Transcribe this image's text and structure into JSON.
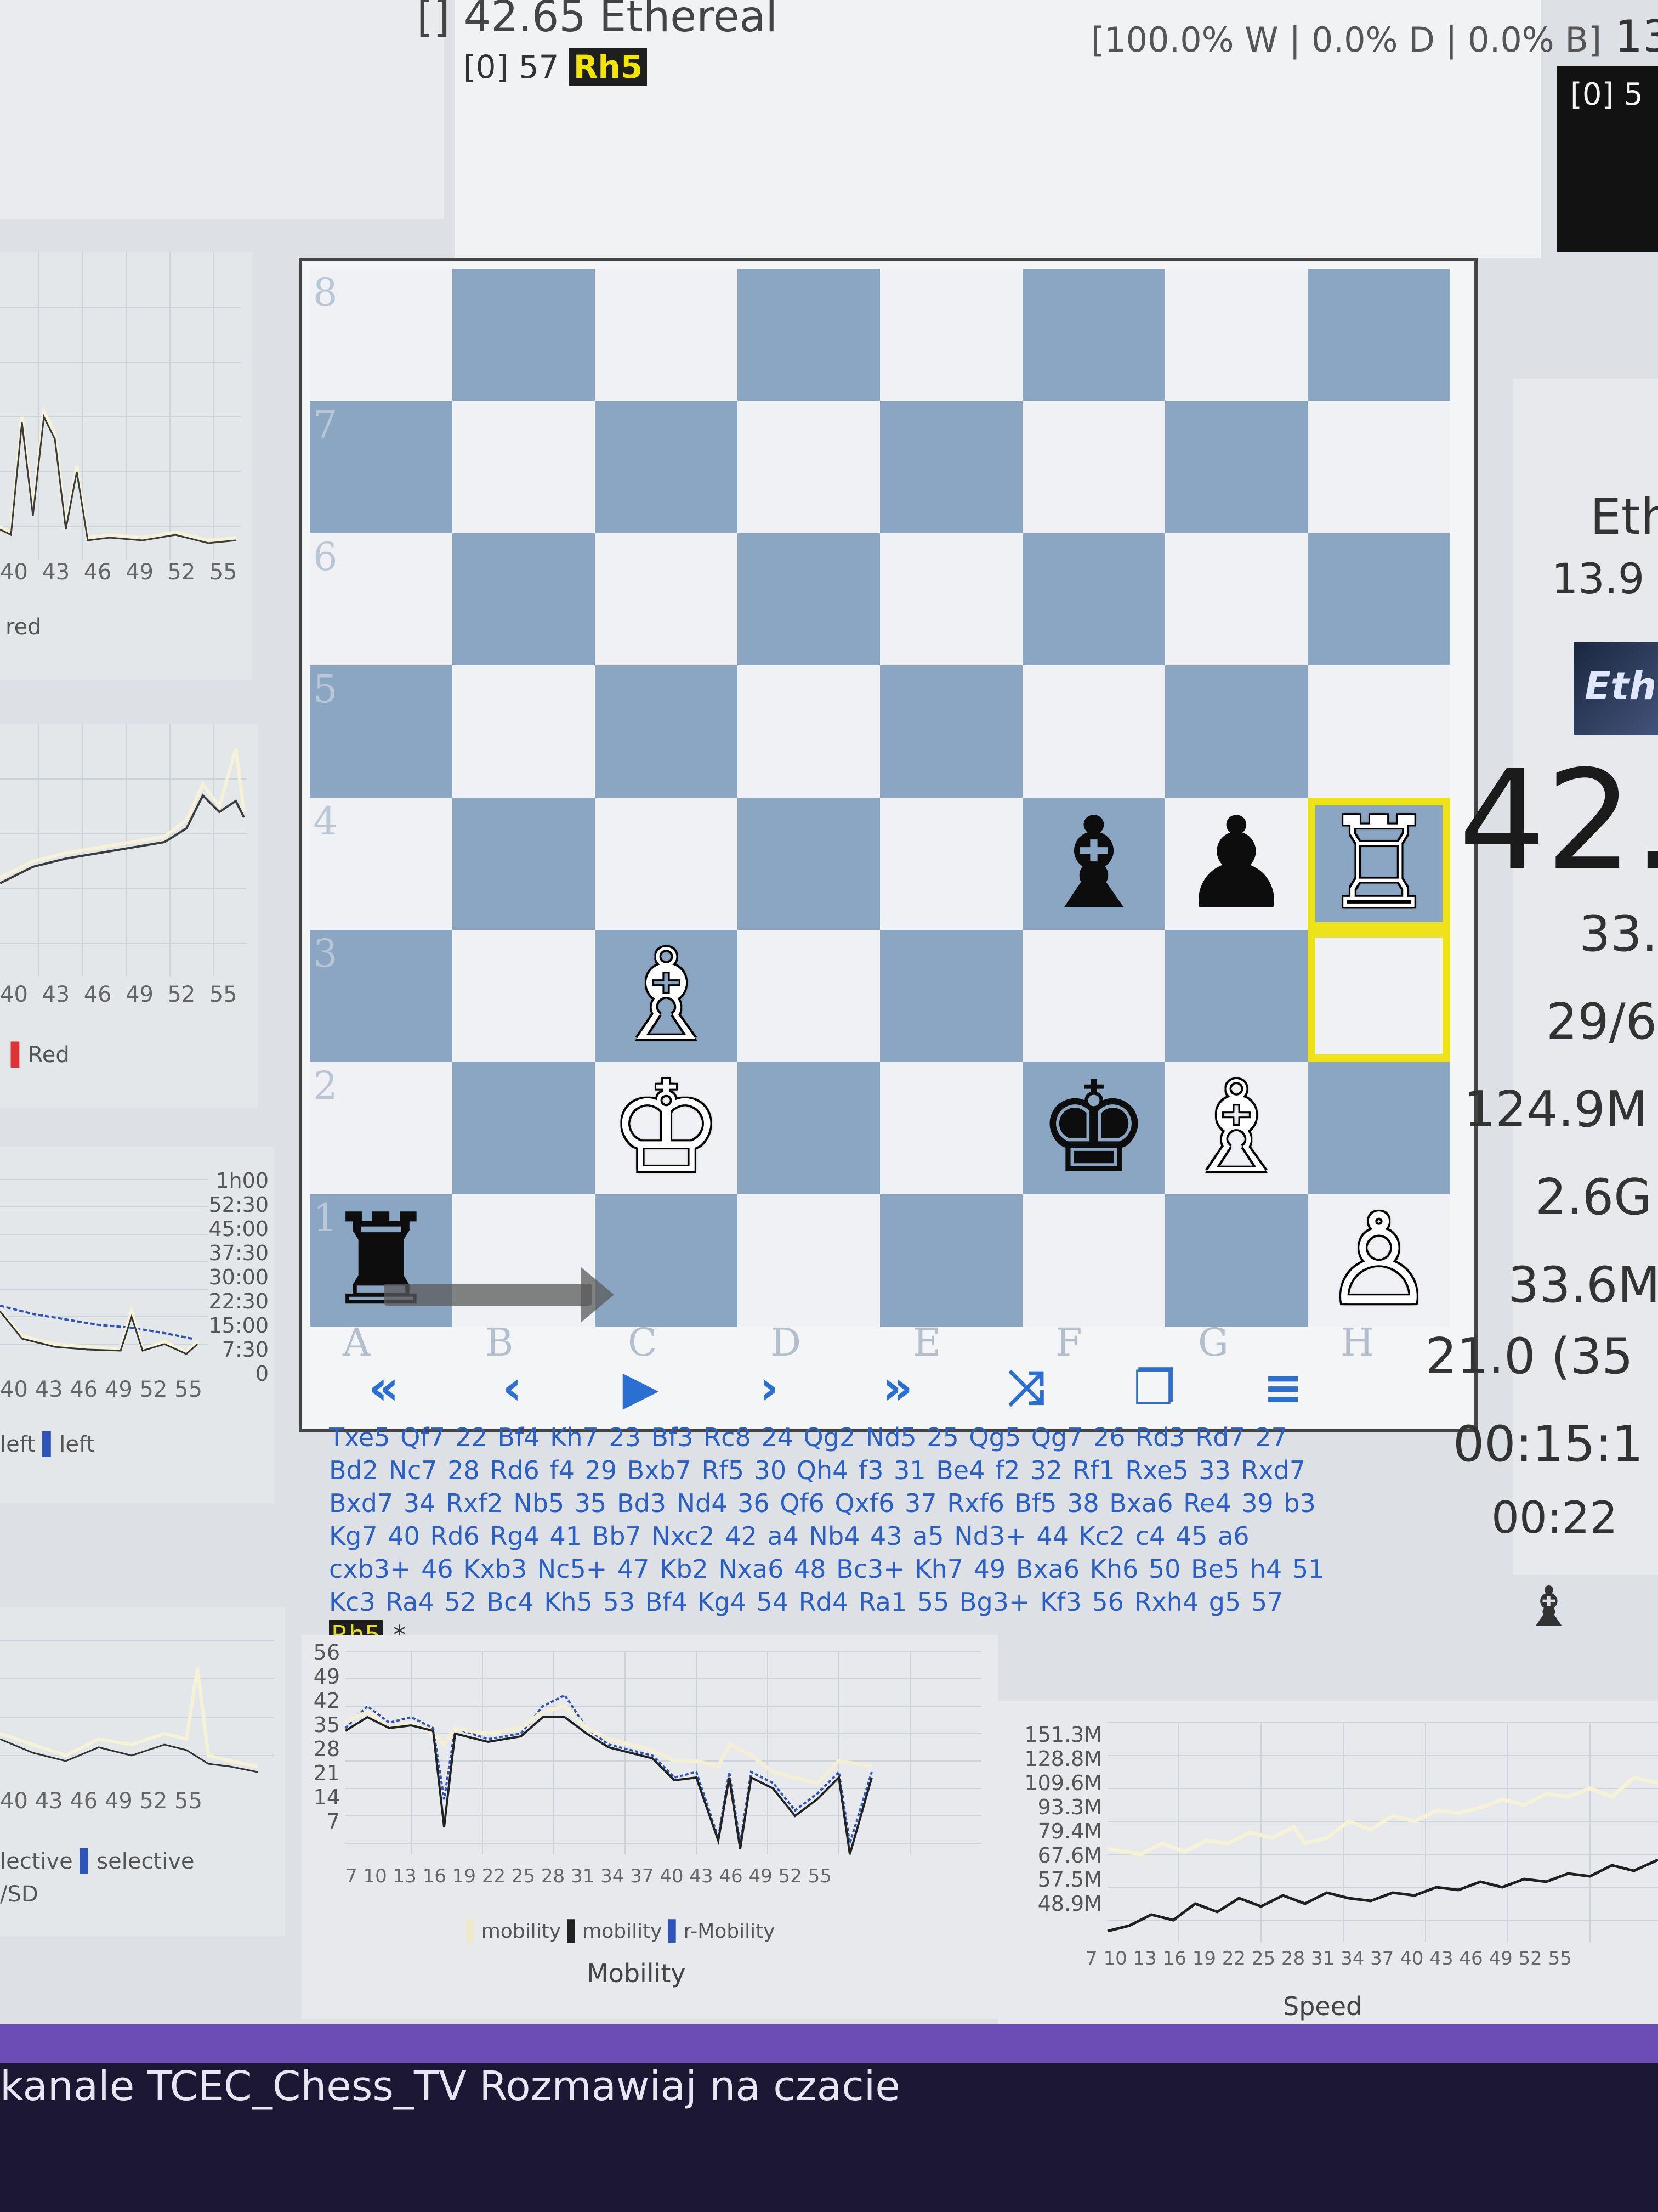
{
  "header": {
    "engine_line_prefix": "[] 42.65",
    "engine_name": "Ethereal",
    "pv_index": "[0]",
    "move_number": "57",
    "current_move": "Rh5",
    "wdl": "[100.0% W | 0.0% D | 0.0% B]",
    "wdl_extra": "13.",
    "right_pv_index": "[0] 5"
  },
  "board": {
    "rank_labels": [
      "8",
      "7",
      "6",
      "5",
      "4",
      "3",
      "2",
      "1"
    ],
    "file_labels": [
      "A",
      "B",
      "C",
      "D",
      "E",
      "F",
      "G",
      "H"
    ],
    "pieces": [
      {
        "square": "f4",
        "symbol": "♝",
        "color": "black"
      },
      {
        "square": "g4",
        "symbol": "♟",
        "color": "black"
      },
      {
        "square": "h4",
        "symbol": "♖",
        "color": "white"
      },
      {
        "square": "c3",
        "symbol": "♗",
        "color": "white"
      },
      {
        "square": "c2",
        "symbol": "♔",
        "color": "white"
      },
      {
        "square": "f2",
        "symbol": "♚",
        "color": "black"
      },
      {
        "square": "g2",
        "symbol": "♗",
        "color": "white"
      },
      {
        "square": "h1",
        "symbol": "♙",
        "color": "white"
      },
      {
        "square": "a1",
        "symbol": "♜",
        "color": "black"
      }
    ],
    "highlighted_squares": [
      "h4",
      "h3"
    ],
    "arrow": "a1-c1"
  },
  "controls": {
    "first": "«",
    "prev": "‹",
    "play": "▶",
    "next": "›",
    "last": "»",
    "flip": "⤨",
    "copy": "❐",
    "menu": "≡"
  },
  "pgn": {
    "moves_text": "Txe5 Qf7 22 Bf4 Kh7 23 Bf3 Rc8 24 Qg2 Nd5 25 Qg5 Qg7 26 Rd3 Rd7 27 Bd2 Nc7 28 Rd6 f4 29 Bxb7 Rf5 30 Qh4 f3 31 Be4 f2 32 Rf1 Rxe5 33 Rxd7 Bxd7 34 Rxf2 Nb5 35 Bd3 Nd4 36 Qf6 Qxf6 37 Rxf6 Bf5 38 Bxa6 Re4 39 b3 Kg7 40 Rd6 Rg4 41 Bb7 Nxc2 42 a4 Nb4 43 a5 Nd3+ 44 Kc2 c4 45 a6 cxb3+ 46 Kxb3 Nc5+ 47 Kb2 Nxa6 48 Bc3+ Kh7 49 Bxa6 Kh6 50 Be5 h4 51 Kc3 Ra4 52 Bc4 Kh5 53 Bf4 Kg4 54 Rd4 Ra1 55 Bg3+ Kf3 56 Rxh4 g5 57",
    "current_move": "Rh5",
    "result": "*"
  },
  "right_info": {
    "engine_abbr": "Eth",
    "logo_text": "Eth",
    "rating": "13.9",
    "eval": "42.",
    "depth": "33.",
    "seldepth": "29/6",
    "nodes": "124.9M",
    "tb_hits": "2.6G",
    "speed": "33.6M",
    "hash": "21.0 (35",
    "time_used": "00:15:1",
    "time_move": "00:22",
    "side_icon": "♝"
  },
  "left_charts": {
    "chart1": {
      "ticks": [
        "40",
        "43",
        "46",
        "49",
        "52",
        "55"
      ],
      "legend": "red"
    },
    "chart2": {
      "ticks": [
        "40",
        "43",
        "46",
        "49",
        "52",
        "55"
      ],
      "legend": "Red"
    },
    "chart3": {
      "ticks": [
        "40",
        "43",
        "46",
        "49",
        "52",
        "55"
      ],
      "yticks": [
        "1h00",
        "52:30",
        "45:00",
        "37:30",
        "30:00",
        "22:30",
        "15:00",
        "7:30",
        "0"
      ],
      "legend_a": "left",
      "legend_b": "left"
    },
    "chart4": {
      "ticks": [
        "40",
        "43",
        "46",
        "49",
        "52",
        "55"
      ],
      "legend_a": "lective",
      "legend_b": "selective",
      "legend_c": "/SD"
    }
  },
  "bottom_charts": {
    "mobility": {
      "title": "Mobility",
      "yticks": [
        "56",
        "49",
        "42",
        "35",
        "28",
        "21",
        "14",
        "7"
      ],
      "xticks": [
        "7",
        "10",
        "13",
        "16",
        "19",
        "22",
        "25",
        "28",
        "31",
        "34",
        "37",
        "40",
        "43",
        "46",
        "49",
        "52",
        "55"
      ],
      "legend": [
        "mobility",
        "mobility",
        "r-Mobility"
      ]
    },
    "speed": {
      "title": "Speed",
      "yticks": [
        "151.3M",
        "128.8M",
        "109.6M",
        "93.3M",
        "79.4M",
        "67.6M",
        "57.5M",
        "48.9M"
      ],
      "xticks": [
        "7",
        "10",
        "13",
        "16",
        "19",
        "22",
        "25",
        "28",
        "31",
        "34",
        "37",
        "40",
        "43",
        "46",
        "49",
        "52",
        "55"
      ]
    }
  },
  "banner": {
    "text": "kanale TCEC_Chess_TV  Rozmawiaj na czacie"
  }
}
